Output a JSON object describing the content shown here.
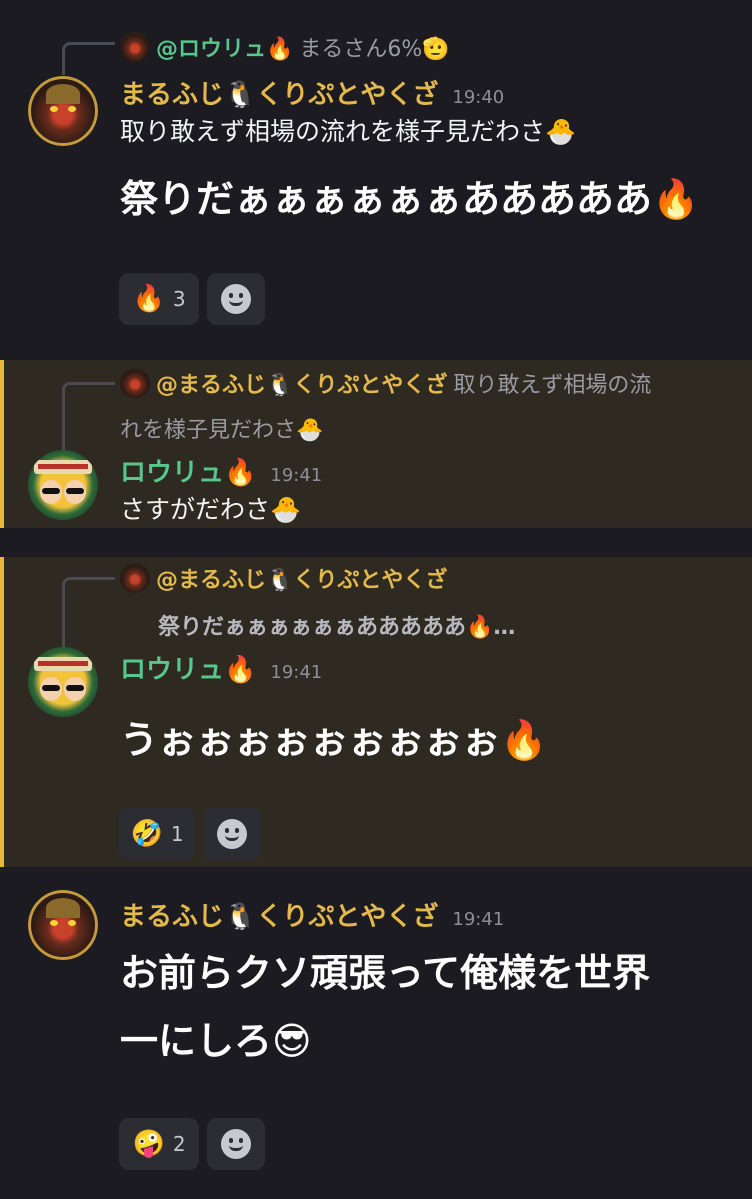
{
  "messages": [
    {
      "reply": {
        "name": "@ロウリュ🔥",
        "text": "まるさん6%🫡"
      },
      "author": "まるふじ🐧くりぷとやくざ",
      "time": "19:40",
      "text": "取り敢えず相場の流れを様子見だわさ🐣",
      "big": "祭りだぁぁぁぁぁぁあああああ🔥",
      "reaction": {
        "emoji": "🔥",
        "count": "3"
      }
    },
    {
      "reply": {
        "name": "@まるふじ🐧くりぷとやくざ",
        "text": "取り敢えず相場の流",
        "text2": "れを様子見だわさ🐣"
      },
      "author": "ロウリュ🔥",
      "time": "19:41",
      "text": "さすがだわさ🐣"
    },
    {
      "reply": {
        "name": "@まるふじ🐧くりぷとやくざ",
        "text": "祭りだぁぁぁぁぁぁあああああ🔥…"
      },
      "author": "ロウリュ🔥",
      "time": "19:41",
      "big": "うぉぉぉぉぉぉぉぉぉ🔥",
      "reaction": {
        "emoji": "🤣",
        "count": "1"
      }
    },
    {
      "author": "まるふじ🐧くりぷとやくざ",
      "time": "19:41",
      "big1": "お前らクソ頑張って俺様を世界",
      "big2": "一にしろ😎",
      "reaction": {
        "emoji": "🤪",
        "count": "2"
      }
    }
  ],
  "colors": {
    "background": "#1b1b21",
    "highlight": "#2e2a22",
    "accent": "#e9b73a",
    "gold_name": "#e4b94a",
    "green_name": "#57c78b"
  },
  "icons": {
    "add_reaction": "smile-icon"
  }
}
